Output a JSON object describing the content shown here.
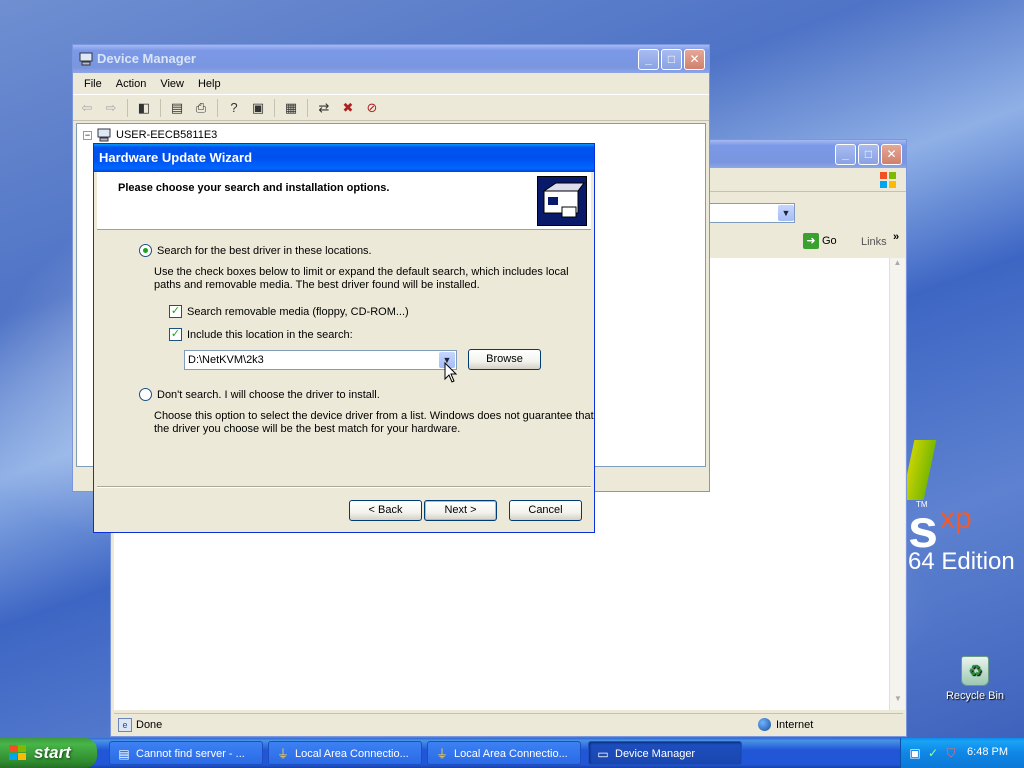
{
  "desktop": {
    "logo_tm": "TM",
    "logo_xp": "xp",
    "logo_s": "s",
    "logo_edition": "64 Edition",
    "recycle_bin_label": "Recycle Bin"
  },
  "browser_window": {
    "go_label": "Go",
    "links_label": "Links",
    "status_text": "Done",
    "zone_text": "Internet"
  },
  "device_manager": {
    "title": "Device Manager",
    "menu": [
      "File",
      "Action",
      "View",
      "Help"
    ],
    "root_node": "USER-EECB5811E3"
  },
  "wizard": {
    "title": "Hardware Update Wizard",
    "heading": "Please choose your search and installation options.",
    "option_search_label": "Search for the best driver in these locations.",
    "option_search_selected": true,
    "search_desc_line1": "Use the check boxes below to limit or expand the default search, which includes local",
    "search_desc_line2": "paths and removable media. The best driver found will be installed.",
    "check_removable_label": "Search removable media (floppy, CD-ROM...)",
    "check_removable_checked": true,
    "check_location_label": "Include this location in the search:",
    "check_location_checked": true,
    "location_value": "D:\\NetKVM\\2k3",
    "browse_label": "Browse",
    "option_dont_search_label": "Don't search. I will choose the driver to install.",
    "dont_desc_line1": "Choose this option to select the device driver from a list.  Windows does not guarantee that",
    "dont_desc_line2": "the driver you choose will be the best match for your hardware.",
    "back_label": "< Back",
    "next_label": "Next >",
    "cancel_label": "Cancel"
  },
  "taskbar": {
    "start_label": "start",
    "tasks": [
      {
        "label": "Cannot find server - ...",
        "icon": "ie-page-icon"
      },
      {
        "label": "Local Area Connectio...",
        "icon": "network-icon"
      },
      {
        "label": "Local Area Connectio...",
        "icon": "network-icon"
      },
      {
        "label": "Device Manager",
        "icon": "computer-icon",
        "active": true
      }
    ],
    "clock": "6:48 PM"
  },
  "colors": {
    "title_active": "#0053ee",
    "start_green": "#3c9b3c",
    "radio_dot": "#21a121"
  }
}
